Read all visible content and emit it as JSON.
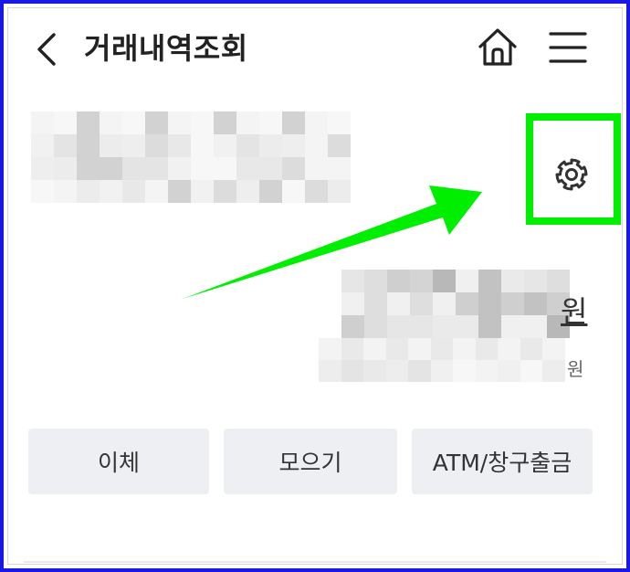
{
  "header": {
    "title": "거래내역조회",
    "back_icon": "chevron-left-icon",
    "home_icon": "home-icon",
    "menu_icon": "hamburger-menu-icon"
  },
  "account": {
    "settings_icon": "gear-icon"
  },
  "balance": {
    "unit": "원",
    "sub_unit": "원"
  },
  "actions": [
    {
      "label": "이체"
    },
    {
      "label": "모으기"
    },
    {
      "label": "ATM/창구출금"
    }
  ],
  "colors": {
    "frame_border": "#1a18e6",
    "highlight": "#00ee00",
    "button_bg": "#edeff2",
    "title_text": "#222222"
  }
}
